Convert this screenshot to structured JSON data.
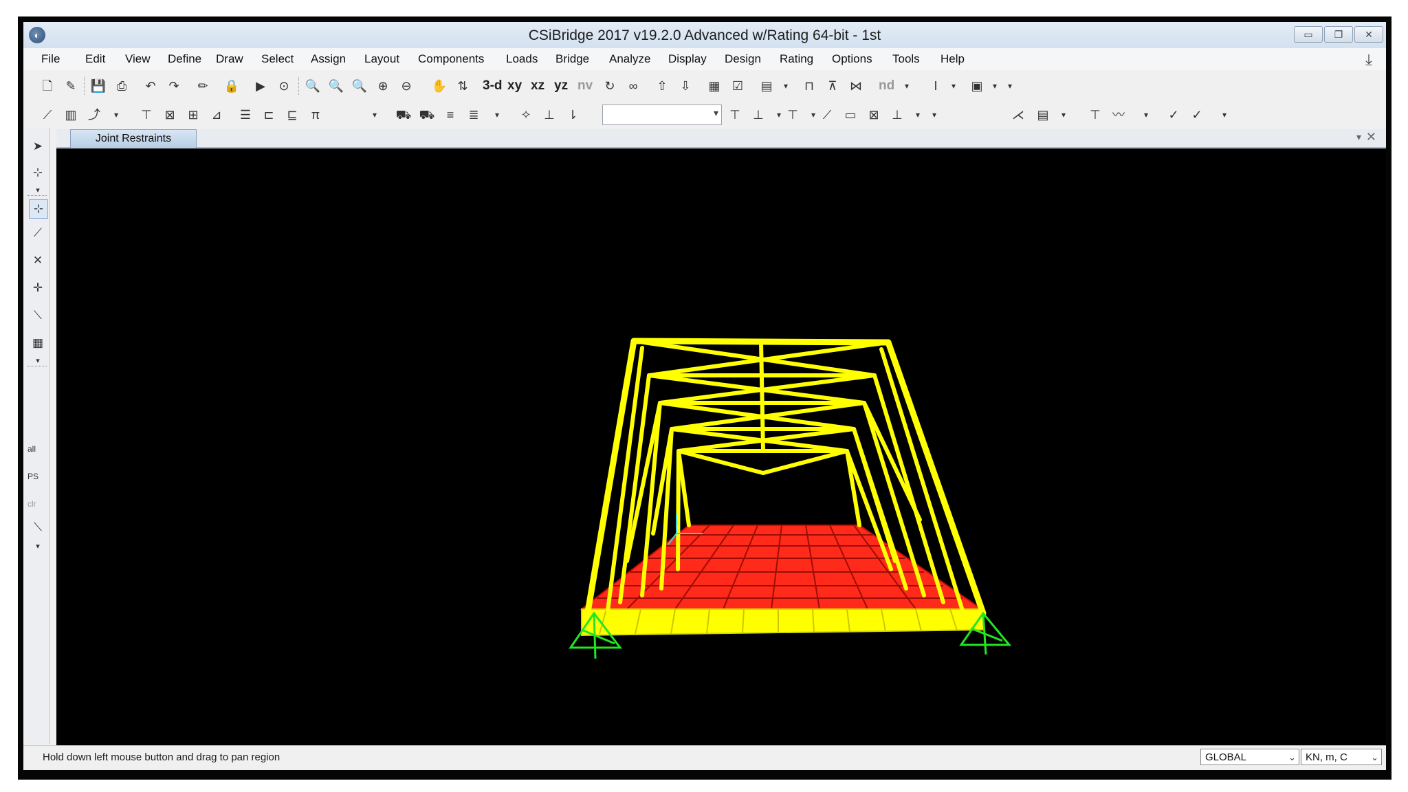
{
  "window": {
    "title": "CSiBridge 2017 v19.2.0 Advanced w/Rating 64-bit - 1st",
    "app_icon": "csi-logo-icon",
    "controls": [
      "minimize",
      "restore",
      "close"
    ]
  },
  "menu": [
    "File",
    "Edit",
    "View",
    "Define",
    "Draw",
    "Select",
    "Assign",
    "Layout",
    "Components",
    "Loads",
    "Bridge",
    "Analyze",
    "Display",
    "Design",
    "Rating",
    "Options",
    "Tools",
    "Help"
  ],
  "toolbar1": {
    "view_labels": [
      "3-d",
      "xy",
      "xz",
      "yz",
      "nv"
    ],
    "extra_label": "nd"
  },
  "document": {
    "tab_label": "Joint Restraints"
  },
  "left_toolbar": {
    "labels": [
      "all",
      "PS",
      "clr"
    ]
  },
  "viewport": {
    "background": "#000000",
    "frame_color": "#ffff00",
    "deck_color": "#ff2a1a",
    "support_color": "#22e622",
    "axis_color": "#3fd8d8"
  },
  "status": {
    "message": "Hold down left mouse button and drag to pan region",
    "coord_system": "GLOBAL",
    "units": "KN, m, C"
  }
}
